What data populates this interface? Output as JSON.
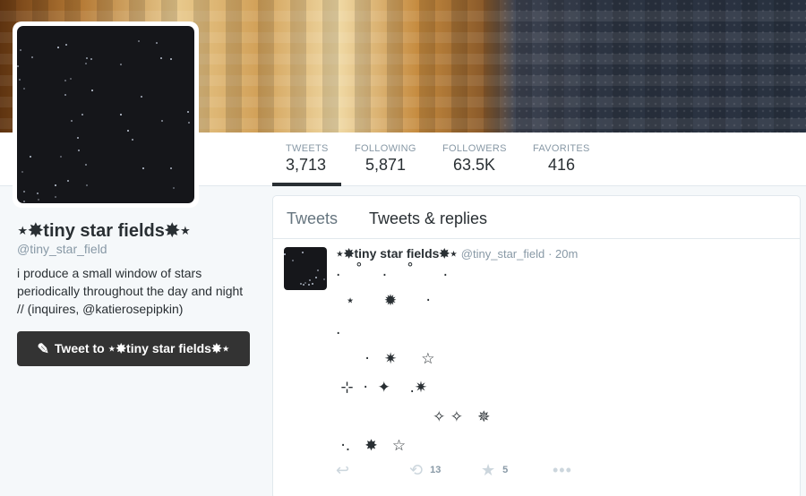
{
  "profile": {
    "name": "⋆✸tiny star fields✸⋆",
    "handle": "@tiny_star_field",
    "bio_line1": "i produce a small window of stars",
    "bio_line2": "periodically throughout the day and night",
    "bio_line3_prefix": "// (inquires, ",
    "bio_link": "@katierosepipkin",
    "bio_line3_suffix": ")",
    "tweet_to_label": "Tweet to ⋆✸tiny star fields✸⋆",
    "tweet_to_icon": "pen-icon"
  },
  "stats": {
    "tweets_label": "TWEETS",
    "tweets_value": "3,713",
    "following_label": "FOLLOWING",
    "following_value": "5,871",
    "followers_label": "FOLLOWERS",
    "followers_value": "63.5K",
    "favorites_label": "FAVORITES",
    "favorites_value": "416"
  },
  "timeline": {
    "tab_tweets": "Tweets",
    "tab_replies": "Tweets & replies",
    "active_tab": "Tweets & replies"
  },
  "tweet": {
    "name": "⋆✸tiny star fields✸⋆",
    "handle": "@tiny_star_field",
    "time": "· 20m",
    "text": ".   ˚    .    ˚      .\n  ⋆      ✹      ·\n.\n      ·   ✷     ☆\n ⊹  ·  ✦    .✷\n                    ✧ ✧   ✵\n ·.   ✸   ☆",
    "reply_icon": "↩",
    "retweet_icon": "⟲",
    "retweet_count": "13",
    "favorite_icon": "★",
    "favorite_count": "5",
    "more_icon": "•••"
  },
  "colors": {
    "accent": "#292f33",
    "muted": "#8899a6",
    "border": "#e1e8ed"
  }
}
